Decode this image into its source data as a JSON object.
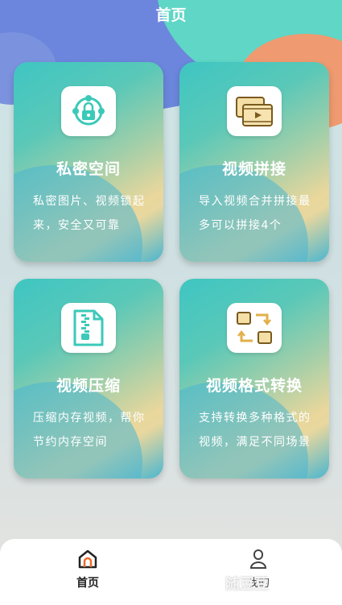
{
  "header": {
    "title": "首页"
  },
  "cards": [
    {
      "title": "私密空间",
      "desc": "私密图片、视频锁起来，安全又可靠",
      "icon": "lock-network-icon"
    },
    {
      "title": "视频拼接",
      "desc": "导入视频合并拼接最多可以拼接4个",
      "icon": "video-merge-icon"
    },
    {
      "title": "视频压缩",
      "desc": "压缩内存视频，帮你节约内存空间",
      "icon": "zip-file-icon"
    },
    {
      "title": "视频格式转换",
      "desc": "支持转换多种格式的视频，满足不同场景",
      "icon": "format-convert-icon"
    }
  ],
  "tabbar": {
    "home_label": "首页",
    "mine_label": "我的",
    "active": "home"
  },
  "watermark": "随豆豆"
}
